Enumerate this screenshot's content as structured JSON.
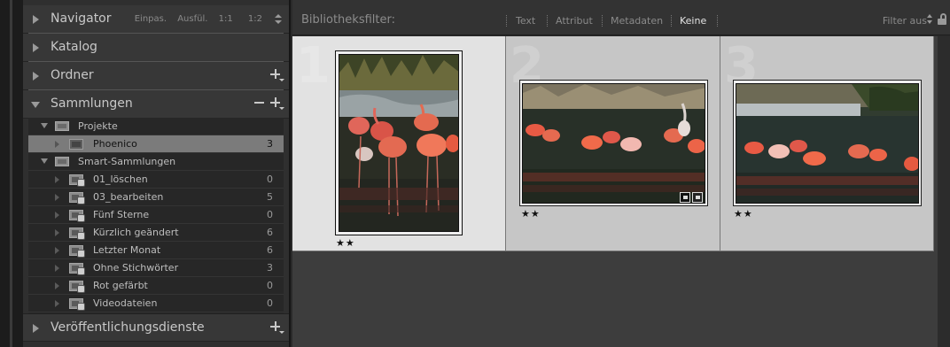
{
  "left_panel": {
    "navigator": {
      "title": "Navigator",
      "zoom_options": [
        "Einpas.",
        "Ausfül.",
        "1:1",
        "1:2"
      ]
    },
    "catalog": {
      "title": "Katalog"
    },
    "folders": {
      "title": "Ordner"
    },
    "collections": {
      "title": "Sammlungen",
      "items": [
        {
          "label": "Projekte",
          "count": "",
          "type": "set",
          "level": 0,
          "expanded": true
        },
        {
          "label": "Phoenico",
          "count": "3",
          "type": "collection",
          "level": 1,
          "selected": true
        },
        {
          "label": "Smart-Sammlungen",
          "count": "",
          "type": "set",
          "level": 0,
          "expanded": true
        },
        {
          "label": "01_löschen",
          "count": "0",
          "type": "smart",
          "level": 1
        },
        {
          "label": "03_bearbeiten",
          "count": "5",
          "type": "smart",
          "level": 1
        },
        {
          "label": "Fünf Sterne",
          "count": "0",
          "type": "smart",
          "level": 1
        },
        {
          "label": "Kürzlich geändert",
          "count": "6",
          "type": "smart",
          "level": 1
        },
        {
          "label": "Letzter Monat",
          "count": "6",
          "type": "smart",
          "level": 1
        },
        {
          "label": "Ohne Stichwörter",
          "count": "3",
          "type": "smart",
          "level": 1
        },
        {
          "label": "Rot gefärbt",
          "count": "0",
          "type": "smart",
          "level": 1
        },
        {
          "label": "Videodateien",
          "count": "0",
          "type": "smart",
          "level": 1
        }
      ]
    },
    "publish": {
      "title": "Veröffentlichungsdienste"
    }
  },
  "filter_bar": {
    "title": "Bibliotheksfilter:",
    "tabs": [
      "Text",
      "Attribut",
      "Metadaten",
      "Keine"
    ],
    "active_tab": "Keine",
    "preset": "Filter aus"
  },
  "grid": {
    "cells": [
      {
        "index": "1",
        "stars": "★★",
        "orientation": "portrait",
        "selected": true,
        "badges": false
      },
      {
        "index": "2",
        "stars": "★★",
        "orientation": "landscape",
        "selected": false,
        "badges": true
      },
      {
        "index": "3",
        "stars": "★★",
        "orientation": "landscape",
        "selected": false,
        "badges": false
      }
    ]
  },
  "colors": {
    "panel_bg": "#2f2f2f",
    "selected_row": "#7b7b7b",
    "selected_cell": "#e2e2e2",
    "cell_bg": "#c6c6c6",
    "grid_bg": "#3d3d3d"
  }
}
